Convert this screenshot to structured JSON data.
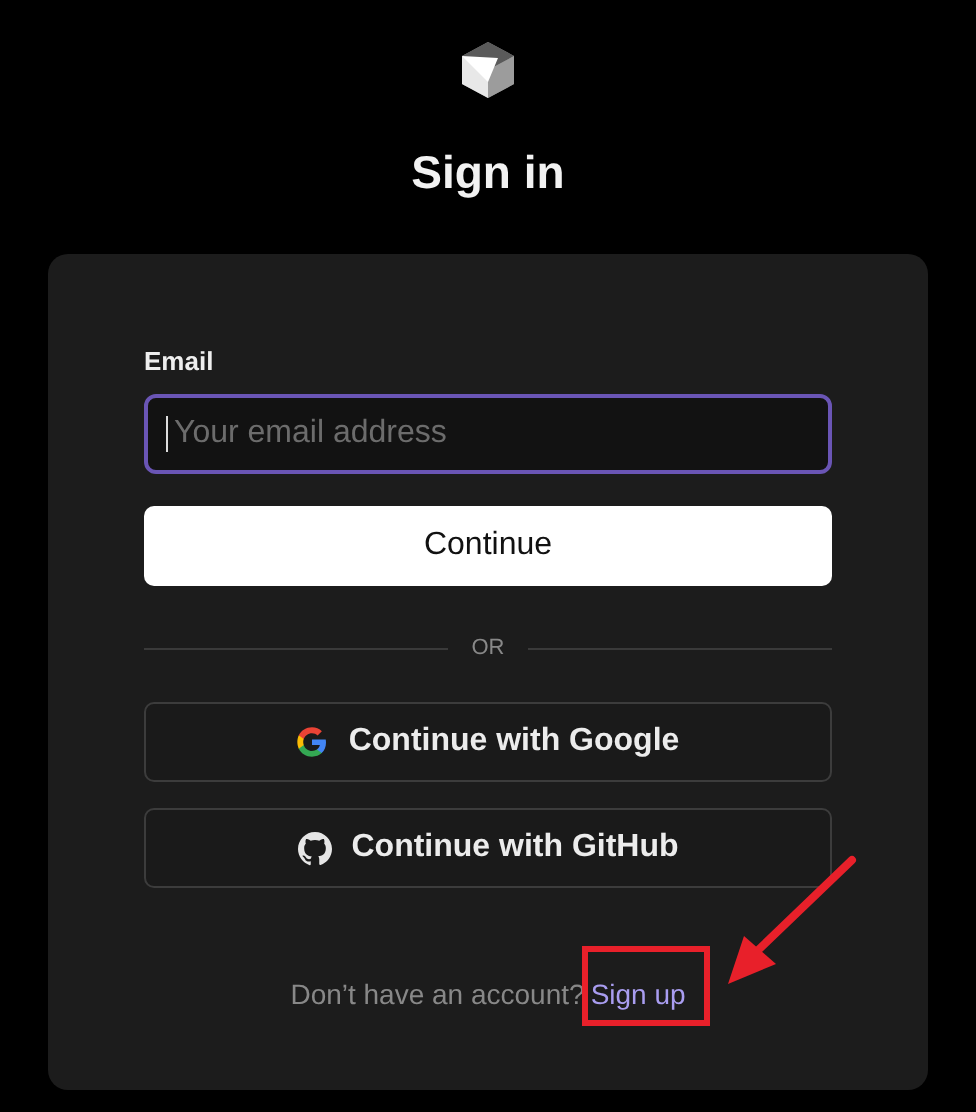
{
  "title": "Sign in",
  "email": {
    "label": "Email",
    "placeholder": "Your email address",
    "focused": true
  },
  "continue_button": "Continue",
  "divider": "OR",
  "providers": [
    {
      "kind": "google",
      "label": "Continue with Google"
    },
    {
      "kind": "github",
      "label": "Continue with GitHub"
    }
  ],
  "footer": {
    "text": "Don’t have an account?",
    "link": "Sign up"
  }
}
